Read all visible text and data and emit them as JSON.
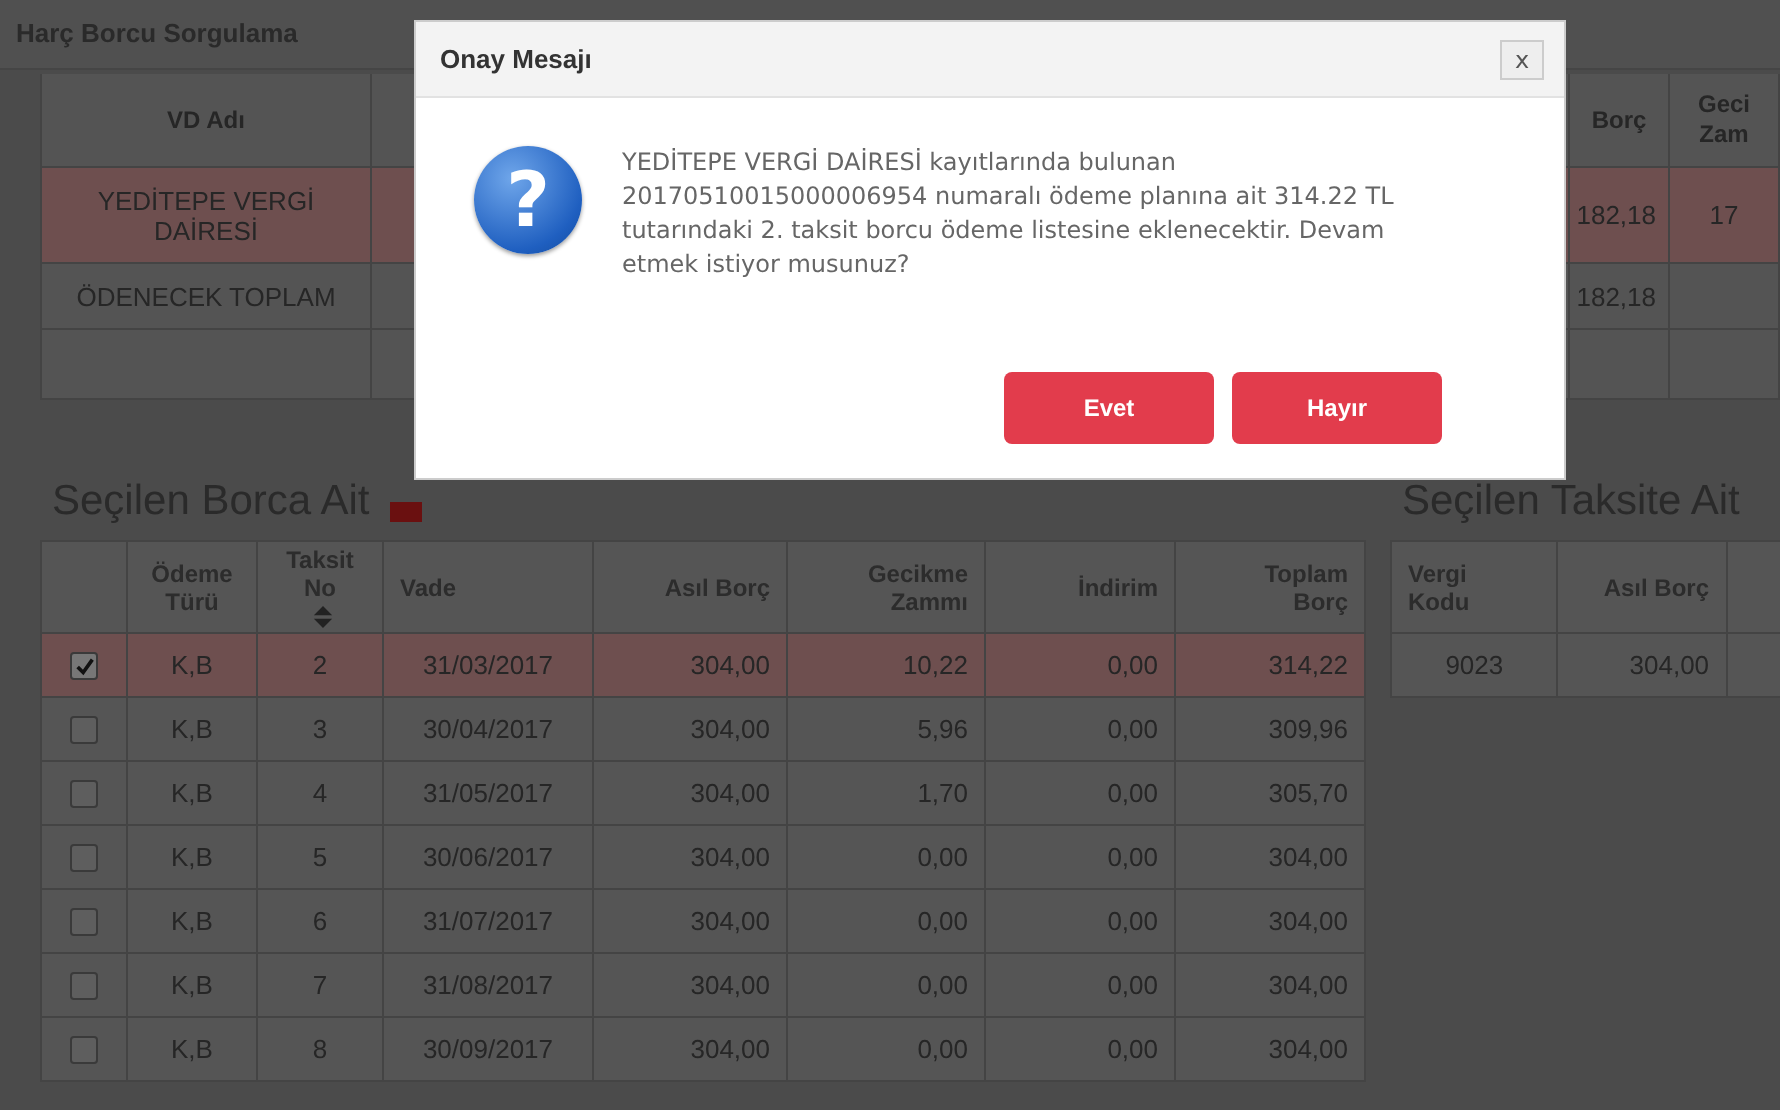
{
  "page_title": "Harç Borcu Sorgulama",
  "debt_table": {
    "columns": [
      {
        "label": "VD Adı"
      },
      {
        "label": "Borç"
      },
      {
        "label": "Geci\nZam"
      }
    ],
    "rows": [
      {
        "selected": true,
        "cells": [
          "YEDİTEPE VERGİ\nDAİRESİ",
          "182,18",
          "17"
        ]
      },
      {
        "selected": false,
        "cells": [
          "ÖDENECEK TOPLAM",
          "182,18"
        ]
      }
    ]
  },
  "plan_heading": "Seçilen Borca Ait",
  "plan_table": {
    "columns": [
      {
        "label": "Ödeme\nTürü"
      },
      {
        "label": "Taksit\nNo",
        "sortable": true
      },
      {
        "label": "Vade"
      },
      {
        "label": "Asıl Borç"
      },
      {
        "label": "Gecikme\nZammı"
      },
      {
        "label": "İndirim"
      },
      {
        "label": "Toplam\nBorç"
      }
    ],
    "rows": [
      {
        "checked": true,
        "selected": true,
        "cells": [
          "K,B",
          "2",
          "31/03/2017",
          "304,00",
          "10,22",
          "0,00",
          "314,22"
        ]
      },
      {
        "checked": false,
        "selected": false,
        "cells": [
          "K,B",
          "3",
          "30/04/2017",
          "304,00",
          "5,96",
          "0,00",
          "309,96"
        ]
      },
      {
        "checked": false,
        "selected": false,
        "cells": [
          "K,B",
          "4",
          "31/05/2017",
          "304,00",
          "1,70",
          "0,00",
          "305,70"
        ]
      },
      {
        "checked": false,
        "selected": false,
        "cells": [
          "K,B",
          "5",
          "30/06/2017",
          "304,00",
          "0,00",
          "0,00",
          "304,00"
        ]
      },
      {
        "checked": false,
        "selected": false,
        "cells": [
          "K,B",
          "6",
          "31/07/2017",
          "304,00",
          "0,00",
          "0,00",
          "304,00"
        ]
      },
      {
        "checked": false,
        "selected": false,
        "cells": [
          "K,B",
          "7",
          "31/08/2017",
          "304,00",
          "0,00",
          "0,00",
          "304,00"
        ]
      },
      {
        "checked": false,
        "selected": false,
        "cells": [
          "K,B",
          "8",
          "30/09/2017",
          "304,00",
          "0,00",
          "0,00",
          "304,00"
        ]
      }
    ]
  },
  "installment_heading": "Seçilen Taksite Ait",
  "installment_table": {
    "columns": [
      {
        "label": "Vergi\nKodu"
      },
      {
        "label": "Asıl Borç"
      }
    ],
    "rows": [
      {
        "cells": [
          "9023",
          "304,00"
        ]
      }
    ]
  },
  "dialog": {
    "title": "Onay Mesajı",
    "close": "x",
    "icon": "?",
    "message": "YEDİTEPE VERGİ DAİRESİ kayıtlarında bulunan 20170510015000006954 numaralı ödeme planına ait 314.22 TL tutarındaki 2. taksit borcu ödeme listesine eklenecektir. Devam etmek istiyor musunuz?",
    "buttons": [
      "Evet",
      "Hayır"
    ]
  }
}
